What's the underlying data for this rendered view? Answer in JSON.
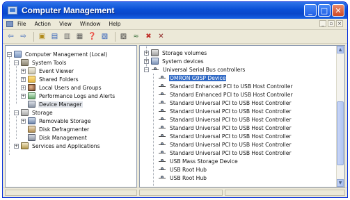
{
  "window": {
    "title": "Computer Management"
  },
  "menu": [
    "File",
    "Action",
    "View",
    "Window",
    "Help"
  ],
  "left_tree": [
    {
      "label": "Computer Management (Local)",
      "icon": "computer-icon",
      "expander": "minus"
    },
    {
      "label": "System Tools",
      "icon": "system-tools-icon",
      "expander": "minus"
    },
    {
      "label": "Event Viewer",
      "icon": "event-viewer-icon",
      "expander": "plus"
    },
    {
      "label": "Shared Folders",
      "icon": "folder-icon",
      "expander": "plus"
    },
    {
      "label": "Local Users and Groups",
      "icon": "users-icon",
      "expander": "plus"
    },
    {
      "label": "Performance Logs and Alerts",
      "icon": "performance-icon",
      "expander": "plus"
    },
    {
      "label": "Device Manager",
      "icon": "device-manager-icon",
      "expander": ""
    },
    {
      "label": "Storage",
      "icon": "storage-icon",
      "expander": "minus"
    },
    {
      "label": "Removable Storage",
      "icon": "removable-storage-icon",
      "expander": "plus"
    },
    {
      "label": "Disk Defragmenter",
      "icon": "defragmenter-icon",
      "expander": ""
    },
    {
      "label": "Disk Management",
      "icon": "disk-management-icon",
      "expander": ""
    },
    {
      "label": "Services and Applications",
      "icon": "services-icon",
      "expander": "plus"
    }
  ],
  "right_tree": [
    {
      "label": "Storage volumes",
      "icon": "storage-volume-icon",
      "expander": "plus"
    },
    {
      "label": "System devices",
      "icon": "system-devices-icon",
      "expander": "plus"
    },
    {
      "label": "Universal Serial Bus controllers",
      "icon": "usb-icon",
      "expander": "minus"
    },
    {
      "label": "OMRON G9SP Device",
      "icon": "usb-icon",
      "selected": true
    },
    {
      "label": "Standard Enhanced PCI to USB Host Controller",
      "icon": "usb-icon"
    },
    {
      "label": "Standard Enhanced PCI to USB Host Controller",
      "icon": "usb-icon"
    },
    {
      "label": "Standard Universal PCI to USB Host Controller",
      "icon": "usb-icon"
    },
    {
      "label": "Standard Universal PCI to USB Host Controller",
      "icon": "usb-icon"
    },
    {
      "label": "Standard Universal PCI to USB Host Controller",
      "icon": "usb-icon"
    },
    {
      "label": "Standard Universal PCI to USB Host Controller",
      "icon": "usb-icon"
    },
    {
      "label": "Standard Universal PCI to USB Host Controller",
      "icon": "usb-icon"
    },
    {
      "label": "Standard Universal PCI to USB Host Controller",
      "icon": "usb-icon"
    },
    {
      "label": "Standard Universal PCI to USB Host Controller",
      "icon": "usb-icon"
    },
    {
      "label": "USB Mass Storage Device",
      "icon": "usb-icon"
    },
    {
      "label": "USB Root Hub",
      "icon": "usb-icon"
    },
    {
      "label": "USB Root Hub",
      "icon": "usb-icon"
    }
  ],
  "colors": {
    "titlebar": "#0a4fd6",
    "selection": "#316ac5",
    "chrome": "#ece9d8"
  }
}
